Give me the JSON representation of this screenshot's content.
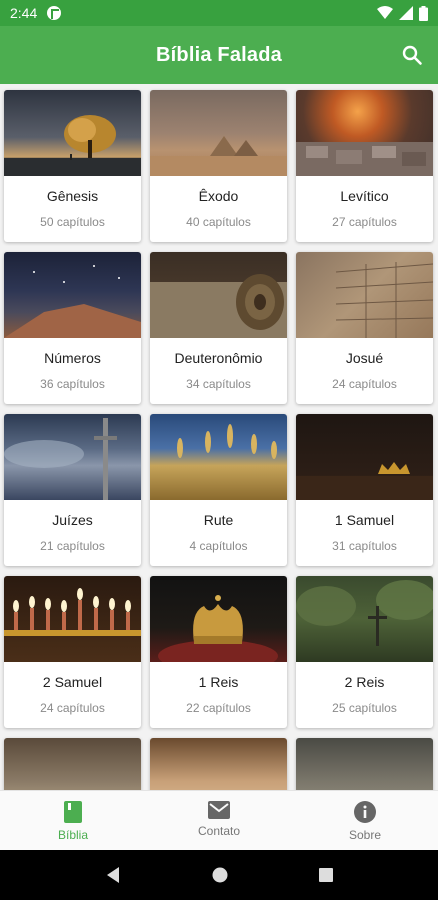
{
  "status": {
    "time": "2:44"
  },
  "appbar": {
    "title": "Bíblia Falada",
    "search_icon": "search-icon"
  },
  "books": [
    {
      "name": "Gênesis",
      "chapters": "50 capítulos",
      "image": "tree-at-sunset"
    },
    {
      "name": "Êxodo",
      "chapters": "40 capítulos",
      "image": "pyramids-desert"
    },
    {
      "name": "Levítico",
      "chapters": "27 capítulos",
      "image": "altar-fire"
    },
    {
      "name": "Números",
      "chapters": "36 capítulos",
      "image": "desert-night-sky"
    },
    {
      "name": "Deuteronômio",
      "chapters": "34 capítulos",
      "image": "scroll"
    },
    {
      "name": "Josué",
      "chapters": "24 capítulos",
      "image": "stone-wall"
    },
    {
      "name": "Juízes",
      "chapters": "21 capítulos",
      "image": "sword-sky"
    },
    {
      "name": "Rute",
      "chapters": "4 capítulos",
      "image": "wheat-field"
    },
    {
      "name": "1 Samuel",
      "chapters": "31 capítulos",
      "image": "crown-dark"
    },
    {
      "name": "2 Samuel",
      "chapters": "24 capítulos",
      "image": "menorah-candles"
    },
    {
      "name": "1 Reis",
      "chapters": "22 capítulos",
      "image": "royal-crown"
    },
    {
      "name": "2 Reis",
      "chapters": "25 capítulos",
      "image": "forest-cross"
    },
    {
      "name": "",
      "chapters": "",
      "image": "open-book"
    },
    {
      "name": "",
      "chapters": "",
      "image": "parchment"
    },
    {
      "name": "",
      "chapters": "",
      "image": "old-building"
    }
  ],
  "bottom_nav": [
    {
      "label": "Bíblia",
      "icon": "book-icon",
      "active": true
    },
    {
      "label": "Contato",
      "icon": "mail-icon",
      "active": false
    },
    {
      "label": "Sobre",
      "icon": "info-icon",
      "active": false
    }
  ],
  "colors": {
    "status_bar": "#38a13f",
    "app_bar": "#4cae50",
    "accent": "#4cae50"
  }
}
